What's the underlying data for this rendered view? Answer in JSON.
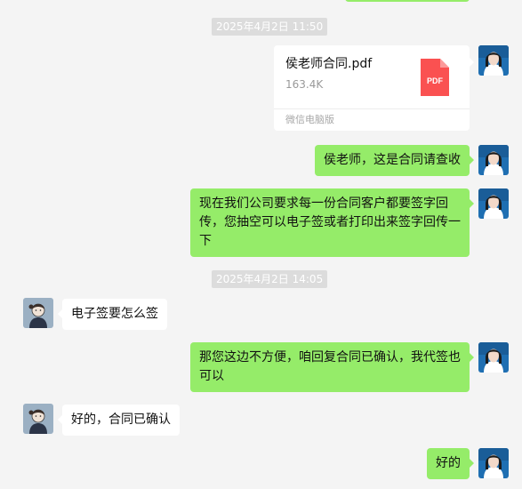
{
  "timestamps": [
    "2025年4月2日 11:50",
    "2025年4月2日 14:05"
  ],
  "file_message": {
    "file_name": "侯老师合同.pdf",
    "file_size": "163.4K",
    "file_type_label": "PDF",
    "source": "微信电脑版",
    "icon": "pdf-file-icon"
  },
  "messages": [
    "侯老师，这是合同请查收",
    "现在我们公司要求每一份合同客户都要签字回传，您抽空可以电子签或者打印出来签字回传一下",
    "电子签要怎么签",
    "那您这边不方便，咱回复合同已确认，我代签也可以",
    "好的，合同已确认",
    "好的"
  ],
  "colors": {
    "background": "#f4f4f4",
    "self_bubble": "#95ec69",
    "other_bubble": "#ffffff",
    "timestamp_bg": "#dcdcdc",
    "pdf_red": "#fa5151",
    "self_avatar_bg": "#1f6fb2",
    "other_avatar_bg": "#9bb0c3"
  }
}
